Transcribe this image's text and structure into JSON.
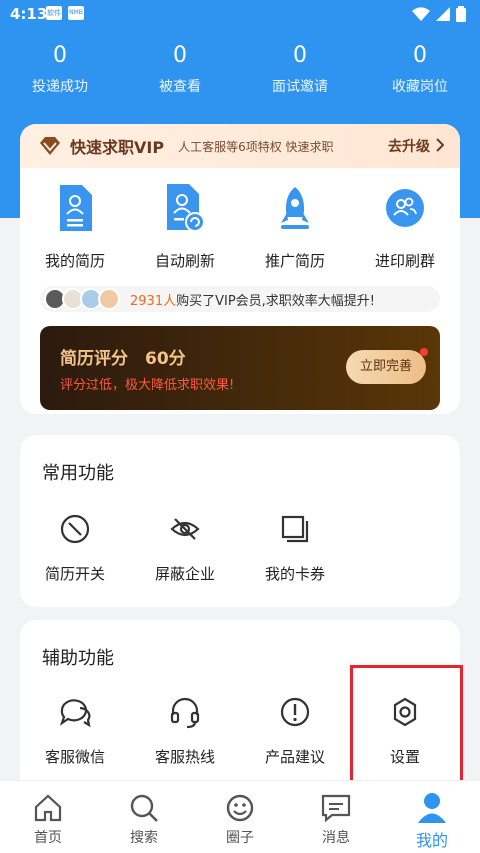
{
  "status_bar": {
    "time": "4:13",
    "notif1": "软件",
    "notif2": "NMB"
  },
  "stats": [
    {
      "value": "0",
      "label": "投递成功"
    },
    {
      "value": "0",
      "label": "被查看"
    },
    {
      "value": "0",
      "label": "面试邀请"
    },
    {
      "value": "0",
      "label": "收藏岗位"
    }
  ],
  "vip": {
    "title": "快速求职VIP",
    "desc": "人工客服等6项特权 快速求职",
    "upgrade": "去升级"
  },
  "tools": [
    {
      "label": "我的简历",
      "icon": "resume-icon"
    },
    {
      "label": "自动刷新",
      "icon": "auto-refresh-icon"
    },
    {
      "label": "推广简历",
      "icon": "rocket-icon"
    },
    {
      "label": "进印刷群",
      "icon": "group-icon"
    }
  ],
  "buyers": {
    "count": "2931人",
    "text": "购买了VIP会员,求职效率大幅提升!"
  },
  "resume_score": {
    "title": "简历评分　60分",
    "warning": "评分过低，极大降低求职效果!",
    "button": "立即完善"
  },
  "common": {
    "title": "常用功能",
    "items": [
      {
        "label": "简历开关",
        "icon": "toggle-icon"
      },
      {
        "label": "屏蔽企业",
        "icon": "eye-off-icon"
      },
      {
        "label": "我的卡券",
        "icon": "coupon-icon"
      }
    ]
  },
  "assist": {
    "title": "辅助功能",
    "items": [
      {
        "label": "客服微信",
        "icon": "chat-icon"
      },
      {
        "label": "客服热线",
        "icon": "headset-icon"
      },
      {
        "label": "产品建议",
        "icon": "alert-icon"
      },
      {
        "label": "设置",
        "icon": "gear-icon"
      }
    ]
  },
  "tabs": [
    {
      "label": "首页",
      "icon": "home-icon"
    },
    {
      "label": "搜索",
      "icon": "search-icon"
    },
    {
      "label": "圈子",
      "icon": "circle-icon"
    },
    {
      "label": "消息",
      "icon": "message-icon"
    },
    {
      "label": "我的",
      "icon": "user-icon",
      "active": true
    }
  ],
  "colors": {
    "primary": "#2f93f0",
    "highlight": "#e8232b",
    "vip_brown": "#6b3a1e"
  }
}
